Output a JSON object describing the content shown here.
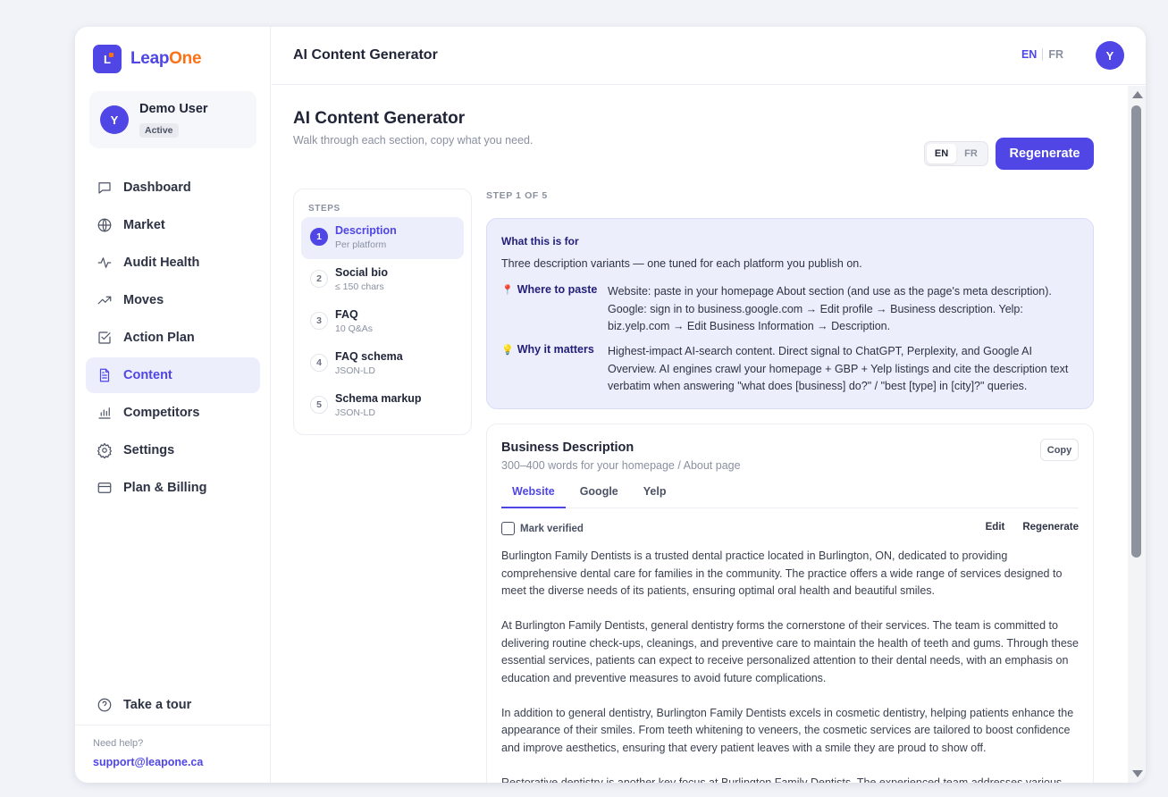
{
  "brand": {
    "logo_letter": "L",
    "name_a": "Leap",
    "name_b": "One"
  },
  "user": {
    "initial": "Y",
    "name": "Demo User",
    "status": "Active"
  },
  "sidebar": {
    "items": [
      {
        "label": "Dashboard",
        "icon": "chat-bubble-icon"
      },
      {
        "label": "Market",
        "icon": "globe-icon"
      },
      {
        "label": "Audit Health",
        "icon": "pulse-icon"
      },
      {
        "label": "Moves",
        "icon": "trend-up-icon"
      },
      {
        "label": "Action Plan",
        "icon": "checkbox-icon"
      },
      {
        "label": "Content",
        "icon": "document-icon",
        "active": true
      },
      {
        "label": "Competitors",
        "icon": "bar-chart-icon"
      },
      {
        "label": "Settings",
        "icon": "gear-icon"
      },
      {
        "label": "Plan & Billing",
        "icon": "credit-card-icon"
      }
    ],
    "tour": "Take a tour",
    "help_label": "Need help?",
    "help_email": "support@leapone.ca"
  },
  "topbar": {
    "title": "AI Content Generator",
    "lang_en": "EN",
    "lang_fr": "FR",
    "avatar_initial": "Y"
  },
  "page": {
    "title": "AI Content Generator",
    "subtitle": "Walk through each section, copy what you need.",
    "lang_en": "EN",
    "lang_fr": "FR",
    "regenerate": "Regenerate"
  },
  "steps": {
    "label": "STEPS",
    "items": [
      {
        "num": "1",
        "title": "Description",
        "sub": "Per platform",
        "active": true
      },
      {
        "num": "2",
        "title": "Social bio",
        "sub": "≤ 150 chars"
      },
      {
        "num": "3",
        "title": "FAQ",
        "sub": "10 Q&As"
      },
      {
        "num": "4",
        "title": "FAQ schema",
        "sub": "JSON-LD"
      },
      {
        "num": "5",
        "title": "Schema markup",
        "sub": "JSON-LD"
      }
    ],
    "progress": "STEP 1 OF 5"
  },
  "info": {
    "heading": "What this is for",
    "intro": "Three description variants — one tuned for each platform you publish on.",
    "where_label": "Where to paste",
    "where_text": "Website: paste in your homepage About section (and use as the page's meta description). Google: sign in to business.google.com → Edit profile → Business description. Yelp: biz.yelp.com → Edit Business Information → Description.",
    "why_label": "Why it matters",
    "why_text": "Highest-impact AI-search content. Direct signal to ChatGPT, Perplexity, and Google AI Overview. AI engines crawl your homepage + GBP + Yelp listings and cite the description text verbatim when answering \"what does [business] do?\" / \"best [type] in [city]?\" queries."
  },
  "card": {
    "title": "Business Description",
    "subtitle": "300–400 words for your homepage / About page",
    "copy": "Copy",
    "tabs": [
      "Website",
      "Google",
      "Yelp"
    ],
    "mark_verified": "Mark verified",
    "edit": "Edit",
    "regenerate": "Regenerate",
    "paragraphs": [
      "Burlington Family Dentists is a trusted dental practice located in Burlington, ON, dedicated to providing comprehensive dental care for families in the community. The practice offers a wide range of services designed to meet the diverse needs of its patients, ensuring optimal oral health and beautiful smiles.",
      "At Burlington Family Dentists, general dentistry forms the cornerstone of their services. The team is committed to delivering routine check-ups, cleanings, and preventive care to maintain the health of teeth and gums. Through these essential services, patients can expect to receive personalized attention to their dental needs, with an emphasis on education and preventive measures to avoid future complications.",
      "In addition to general dentistry, Burlington Family Dentists excels in cosmetic dentistry, helping patients enhance the appearance of their smiles. From teeth whitening to veneers, the cosmetic services are tailored to boost confidence and improve aesthetics, ensuring that every patient leaves with a smile they are proud to show off.",
      "Restorative dentistry is another key focus at Burlington Family Dentists. The experienced team addresses various dental issues such as cavities, damaged teeth, and missing teeth with effective treatment options. This includes"
    ]
  },
  "colors": {
    "accent": "#4f46e5",
    "brand_orange": "#f97316",
    "info_bg": "#eceefc"
  }
}
